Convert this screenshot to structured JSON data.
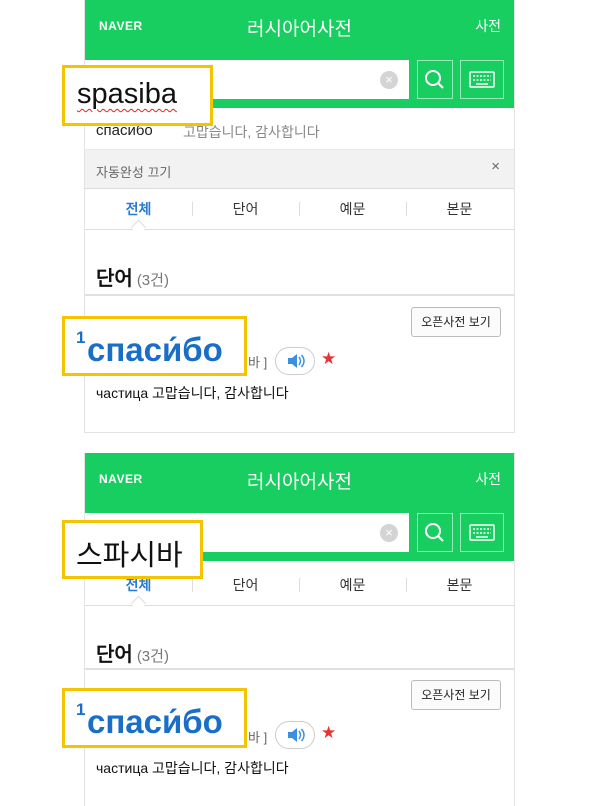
{
  "header": {
    "logo": "NAVER",
    "title": "러시아어사전",
    "dict_link": "사전"
  },
  "search": {
    "clear_glyph": "×",
    "search_icon": "magnifier-icon",
    "keyboard_icon": "keyboard-icon"
  },
  "suggestion": {
    "russian": "спасибо",
    "korean": "고맙습니다, 감사합니다"
  },
  "autocomplete": {
    "label": "자동완성 끄기",
    "close_glyph": "×"
  },
  "tabs": [
    "전체",
    "단어",
    "예문",
    "본문"
  ],
  "section": {
    "title": "단어",
    "count": "(3건)"
  },
  "entry": {
    "open_dict_label": "오픈사전 보기",
    "bracket_fragment": "바 ]",
    "star_glyph": "★",
    "meaning": "частица 고맙습니다, 감사합니다"
  },
  "callouts": {
    "input_latin": "spasiba",
    "headword": "спаси́бо",
    "headword_sup": "1",
    "input_korean": "스파시바"
  },
  "colors": {
    "naver_green": "#19ce60",
    "accent_blue": "#2a7bd6",
    "callout_border": "#f5c400",
    "star_red": "#e53434"
  }
}
